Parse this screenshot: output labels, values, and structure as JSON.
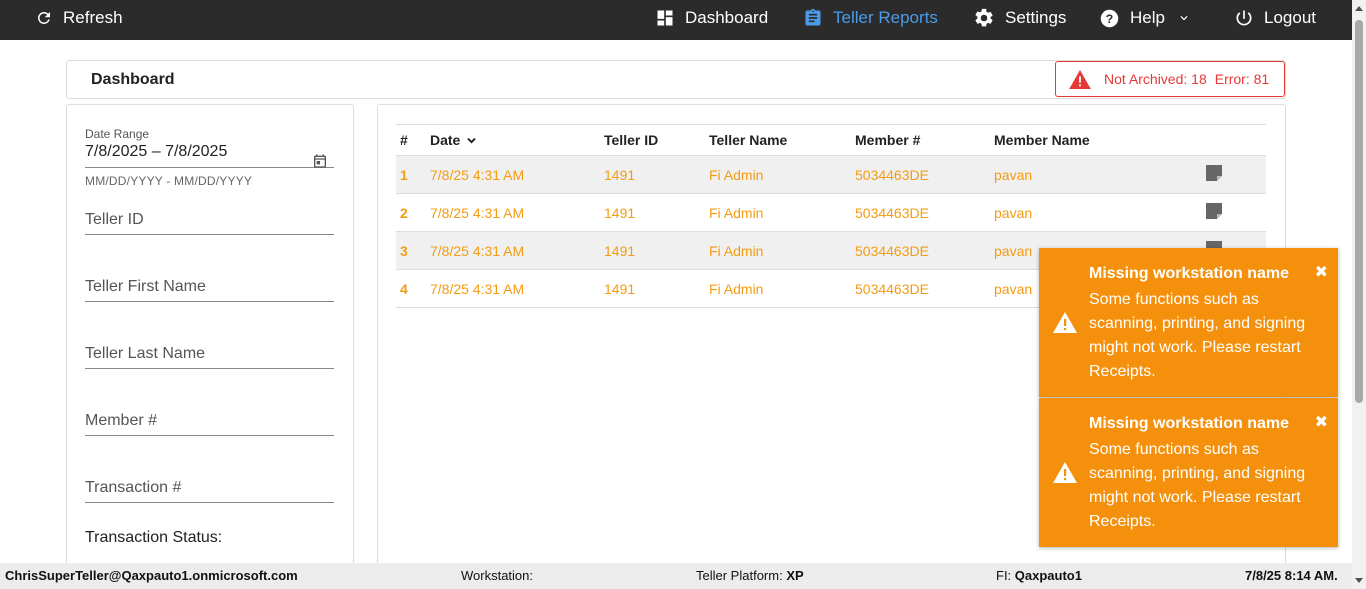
{
  "nav": {
    "refresh": "Refresh",
    "dashboard": "Dashboard",
    "teller_reports": "Teller Reports",
    "settings": "Settings",
    "help": "Help",
    "logout": "Logout"
  },
  "header": {
    "title": "Dashboard",
    "alert_not_archived": "Not Archived: 18",
    "alert_error": "Error: 81"
  },
  "filters": {
    "date_range_label": "Date Range",
    "date_range_value": "7/8/2025 – 7/8/2025",
    "date_range_hint": "MM/DD/YYYY - MM/DD/YYYY",
    "teller_id": "Teller ID",
    "teller_first_name": "Teller First Name",
    "teller_last_name": "Teller Last Name",
    "member_num": "Member #",
    "transaction_num": "Transaction #",
    "transaction_status": "Transaction Status:"
  },
  "table": {
    "columns": [
      "#",
      "Date",
      "Teller ID",
      "Teller Name",
      "Member #",
      "Member Name"
    ],
    "rows": [
      {
        "num": "1",
        "date": "7/8/25 4:31 AM",
        "teller_id": "1491",
        "teller_name": "Fi Admin",
        "member_num": "5034463DE",
        "member_name": "pavan"
      },
      {
        "num": "2",
        "date": "7/8/25 4:31 AM",
        "teller_id": "1491",
        "teller_name": "Fi Admin",
        "member_num": "5034463DE",
        "member_name": "pavan"
      },
      {
        "num": "3",
        "date": "7/8/25 4:31 AM",
        "teller_id": "1491",
        "teller_name": "Fi Admin",
        "member_num": "5034463DE",
        "member_name": "pavan"
      },
      {
        "num": "4",
        "date": "7/8/25 4:31 AM",
        "teller_id": "1491",
        "teller_name": "Fi Admin",
        "member_num": "5034463DE",
        "member_name": "pavan"
      }
    ]
  },
  "toasts": [
    {
      "title": "Missing workstation name",
      "message": "Some functions such as scanning, printing, and signing might not work. Please restart Receipts.",
      "close": "✖"
    },
    {
      "title": "Missing workstation name",
      "message": "Some functions such as scanning, printing, and signing might not work. Please restart Receipts.",
      "close": "✖"
    }
  ],
  "footer": {
    "user": "ChrisSuperTeller@Qaxpauto1.onmicrosoft.com",
    "workstation_label": "Workstation:",
    "platform_label": "Teller Platform:",
    "platform_value": "XP",
    "fi_label": "FI:",
    "fi_value": "Qaxpauto1",
    "datetime": "7/8/25 8:14 AM."
  },
  "colors": {
    "nav_bg": "#2b2b2b",
    "accent_blue": "#4c9be8",
    "row_text": "#f39c12",
    "toast_bg": "#f5900c",
    "alert_red": "#e53935"
  }
}
